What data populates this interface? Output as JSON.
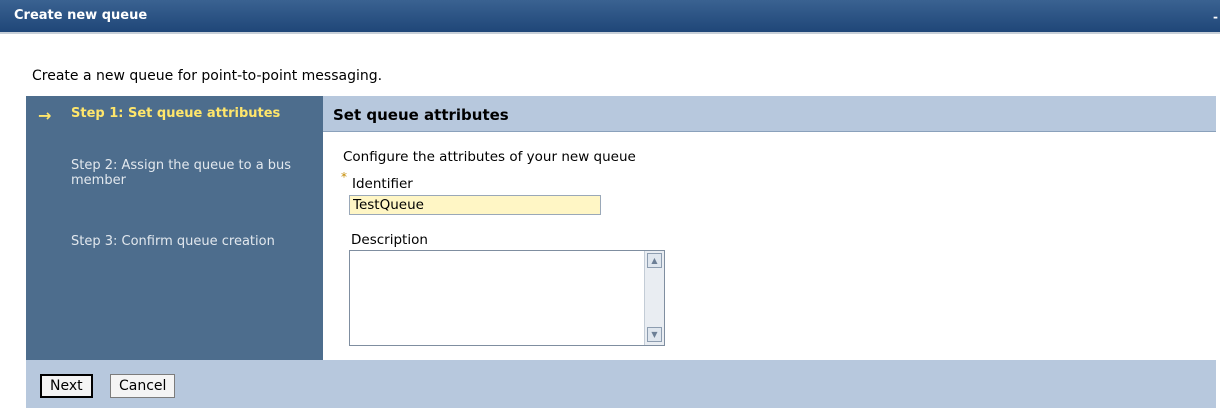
{
  "window": {
    "title": "Create new queue",
    "corner_glyph": "-"
  },
  "intro_text": "Create a new queue for point-to-point messaging.",
  "steps": [
    {
      "label": "Step 1: Set queue attributes",
      "current": true
    },
    {
      "label": "Step 2: Assign the queue to a bus member",
      "current": false
    },
    {
      "label": "Step 3: Confirm queue creation",
      "current": false
    }
  ],
  "current_step_indicator": "arrow-right-icon",
  "panel": {
    "title": "Set queue attributes",
    "subtitle": "Configure the attributes of your new queue",
    "required_marker": "*",
    "identifier_label": "Identifier",
    "identifier_value": "TestQueue",
    "description_label": "Description",
    "description_value": ""
  },
  "buttons": {
    "next": "Next",
    "cancel": "Cancel"
  },
  "colors": {
    "titlebar": "#1f4678",
    "steps_bg": "#4d6d8d",
    "current_step": "#ffe66b",
    "panel_header": "#b7c8dd",
    "required_input_bg": "#fff6c5"
  }
}
